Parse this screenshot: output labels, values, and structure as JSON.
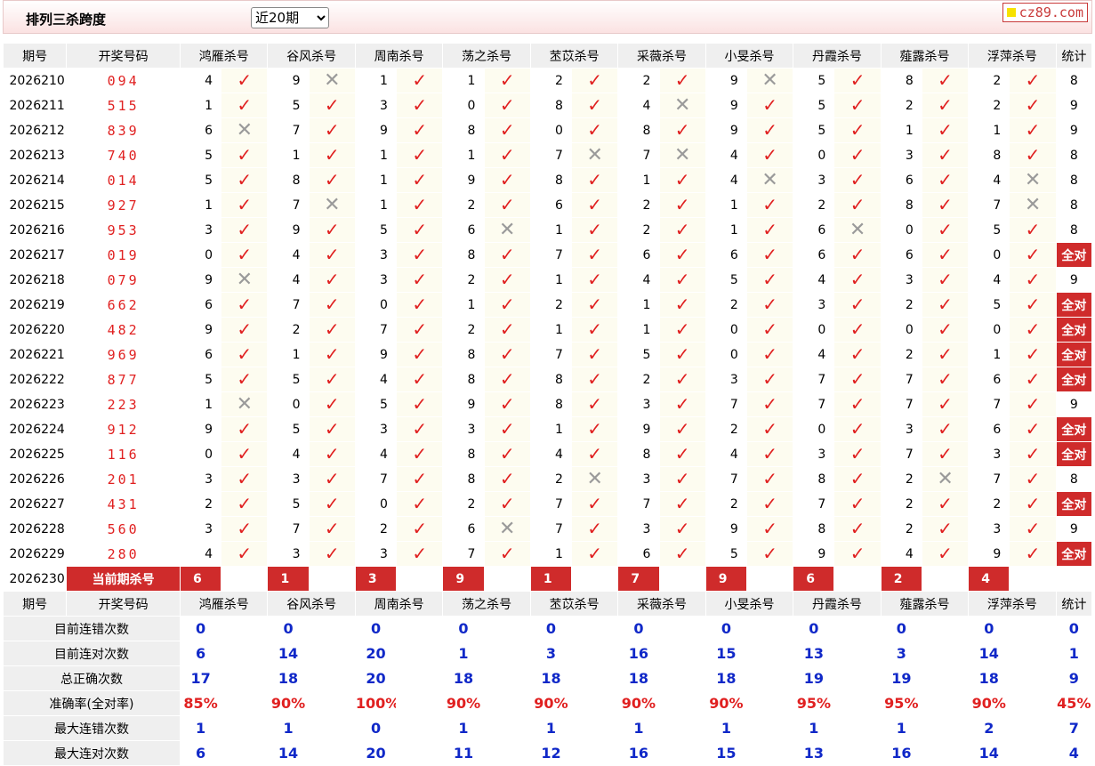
{
  "header": {
    "title": "排列三杀跨度",
    "period_select": "近20期",
    "logo": "cz89.com"
  },
  "columns": {
    "period": "期号",
    "prize": "开奖号码",
    "experts": [
      "鸿雁杀号",
      "谷风杀号",
      "周南杀号",
      "荡之杀号",
      "苤苡杀号",
      "采薇杀号",
      "小旻杀号",
      "丹霞杀号",
      "薤露杀号",
      "浮萍杀号"
    ],
    "stats": "统计"
  },
  "rows": [
    {
      "p": "2026210",
      "n": "094",
      "k": [
        4,
        9,
        1,
        1,
        2,
        2,
        9,
        5,
        8,
        2
      ],
      "r": [
        1,
        0,
        1,
        1,
        1,
        1,
        0,
        1,
        1,
        1
      ],
      "s": "8"
    },
    {
      "p": "2026211",
      "n": "515",
      "k": [
        1,
        5,
        3,
        0,
        8,
        4,
        9,
        5,
        2,
        2
      ],
      "r": [
        1,
        1,
        1,
        1,
        1,
        0,
        1,
        1,
        1,
        1
      ],
      "s": "9"
    },
    {
      "p": "2026212",
      "n": "839",
      "k": [
        6,
        7,
        9,
        8,
        0,
        8,
        9,
        5,
        1,
        1
      ],
      "r": [
        0,
        1,
        1,
        1,
        1,
        1,
        1,
        1,
        1,
        1
      ],
      "s": "9"
    },
    {
      "p": "2026213",
      "n": "740",
      "k": [
        5,
        1,
        1,
        1,
        7,
        7,
        4,
        0,
        3,
        8
      ],
      "r": [
        1,
        1,
        1,
        1,
        0,
        0,
        1,
        1,
        1,
        1
      ],
      "s": "8"
    },
    {
      "p": "2026214",
      "n": "014",
      "k": [
        5,
        8,
        1,
        9,
        8,
        1,
        4,
        3,
        6,
        4
      ],
      "r": [
        1,
        1,
        1,
        1,
        1,
        1,
        0,
        1,
        1,
        0
      ],
      "s": "8"
    },
    {
      "p": "2026215",
      "n": "927",
      "k": [
        1,
        7,
        1,
        2,
        6,
        2,
        1,
        2,
        8,
        7
      ],
      "r": [
        1,
        0,
        1,
        1,
        1,
        1,
        1,
        1,
        1,
        0
      ],
      "s": "8"
    },
    {
      "p": "2026216",
      "n": "953",
      "k": [
        3,
        9,
        5,
        6,
        1,
        2,
        1,
        6,
        0,
        5
      ],
      "r": [
        1,
        1,
        1,
        0,
        1,
        1,
        1,
        0,
        1,
        1
      ],
      "s": "8"
    },
    {
      "p": "2026217",
      "n": "019",
      "k": [
        0,
        4,
        3,
        8,
        7,
        6,
        6,
        6,
        6,
        0
      ],
      "r": [
        1,
        1,
        1,
        1,
        1,
        1,
        1,
        1,
        1,
        1
      ],
      "s": "全对"
    },
    {
      "p": "2026218",
      "n": "079",
      "k": [
        9,
        4,
        3,
        2,
        1,
        4,
        5,
        4,
        3,
        4
      ],
      "r": [
        0,
        1,
        1,
        1,
        1,
        1,
        1,
        1,
        1,
        1
      ],
      "s": "9"
    },
    {
      "p": "2026219",
      "n": "662",
      "k": [
        6,
        7,
        0,
        1,
        2,
        1,
        2,
        3,
        2,
        5
      ],
      "r": [
        1,
        1,
        1,
        1,
        1,
        1,
        1,
        1,
        1,
        1
      ],
      "s": "全对"
    },
    {
      "p": "2026220",
      "n": "482",
      "k": [
        9,
        2,
        7,
        2,
        1,
        1,
        0,
        0,
        0,
        0
      ],
      "r": [
        1,
        1,
        1,
        1,
        1,
        1,
        1,
        1,
        1,
        1
      ],
      "s": "全对"
    },
    {
      "p": "2026221",
      "n": "969",
      "k": [
        6,
        1,
        9,
        8,
        7,
        5,
        0,
        4,
        2,
        1
      ],
      "r": [
        1,
        1,
        1,
        1,
        1,
        1,
        1,
        1,
        1,
        1
      ],
      "s": "全对"
    },
    {
      "p": "2026222",
      "n": "877",
      "k": [
        5,
        5,
        4,
        8,
        8,
        2,
        3,
        7,
        7,
        6
      ],
      "r": [
        1,
        1,
        1,
        1,
        1,
        1,
        1,
        1,
        1,
        1
      ],
      "s": "全对"
    },
    {
      "p": "2026223",
      "n": "223",
      "k": [
        1,
        0,
        5,
        9,
        8,
        3,
        7,
        7,
        7,
        7
      ],
      "r": [
        0,
        1,
        1,
        1,
        1,
        1,
        1,
        1,
        1,
        1
      ],
      "s": "9"
    },
    {
      "p": "2026224",
      "n": "912",
      "k": [
        9,
        5,
        3,
        3,
        1,
        9,
        2,
        0,
        3,
        6
      ],
      "r": [
        1,
        1,
        1,
        1,
        1,
        1,
        1,
        1,
        1,
        1
      ],
      "s": "全对"
    },
    {
      "p": "2026225",
      "n": "116",
      "k": [
        0,
        4,
        4,
        8,
        4,
        8,
        4,
        3,
        7,
        3
      ],
      "r": [
        1,
        1,
        1,
        1,
        1,
        1,
        1,
        1,
        1,
        1
      ],
      "s": "全对"
    },
    {
      "p": "2026226",
      "n": "201",
      "k": [
        3,
        3,
        7,
        8,
        2,
        3,
        7,
        8,
        2,
        7
      ],
      "r": [
        1,
        1,
        1,
        1,
        0,
        1,
        1,
        1,
        0,
        1
      ],
      "s": "8"
    },
    {
      "p": "2026227",
      "n": "431",
      "k": [
        2,
        5,
        0,
        2,
        7,
        7,
        2,
        7,
        2,
        2
      ],
      "r": [
        1,
        1,
        1,
        1,
        1,
        1,
        1,
        1,
        1,
        1
      ],
      "s": "全对"
    },
    {
      "p": "2026228",
      "n": "560",
      "k": [
        3,
        7,
        2,
        6,
        7,
        3,
        9,
        8,
        2,
        3
      ],
      "r": [
        1,
        1,
        1,
        0,
        1,
        1,
        1,
        1,
        1,
        1
      ],
      "s": "9"
    },
    {
      "p": "2026229",
      "n": "280",
      "k": [
        4,
        3,
        3,
        7,
        1,
        6,
        5,
        9,
        4,
        9
      ],
      "r": [
        1,
        1,
        1,
        1,
        1,
        1,
        1,
        1,
        1,
        1
      ],
      "s": "全对"
    }
  ],
  "current": {
    "p": "2026230",
    "label": "当前期杀号",
    "k": [
      6,
      1,
      3,
      9,
      1,
      7,
      9,
      6,
      2,
      4
    ]
  },
  "stats": [
    {
      "label": "目前连错次数",
      "v": [
        "0",
        "0",
        "0",
        "0",
        "0",
        "0",
        "0",
        "0",
        "0",
        "0",
        "0"
      ],
      "pct": false
    },
    {
      "label": "目前连对次数",
      "v": [
        "6",
        "14",
        "20",
        "1",
        "3",
        "16",
        "15",
        "13",
        "3",
        "14",
        "1"
      ],
      "pct": false
    },
    {
      "label": "总正确次数",
      "v": [
        "17",
        "18",
        "20",
        "18",
        "18",
        "18",
        "18",
        "19",
        "19",
        "18",
        "9"
      ],
      "pct": false
    },
    {
      "label": "准确率(全对率)",
      "v": [
        "85%",
        "90%",
        "100%",
        "90%",
        "90%",
        "90%",
        "90%",
        "95%",
        "95%",
        "90%",
        "45%"
      ],
      "pct": true
    },
    {
      "label": "最大连错次数",
      "v": [
        "1",
        "1",
        "0",
        "1",
        "1",
        "1",
        "1",
        "1",
        "1",
        "2",
        "7"
      ],
      "pct": false
    },
    {
      "label": "最大连对次数",
      "v": [
        "6",
        "14",
        "20",
        "11",
        "12",
        "16",
        "15",
        "13",
        "16",
        "14",
        "4"
      ],
      "pct": false
    }
  ],
  "colors": {
    "accent_red": "#cf2b2b",
    "tick": "#e02020",
    "stat_blue": "#1028c8"
  }
}
